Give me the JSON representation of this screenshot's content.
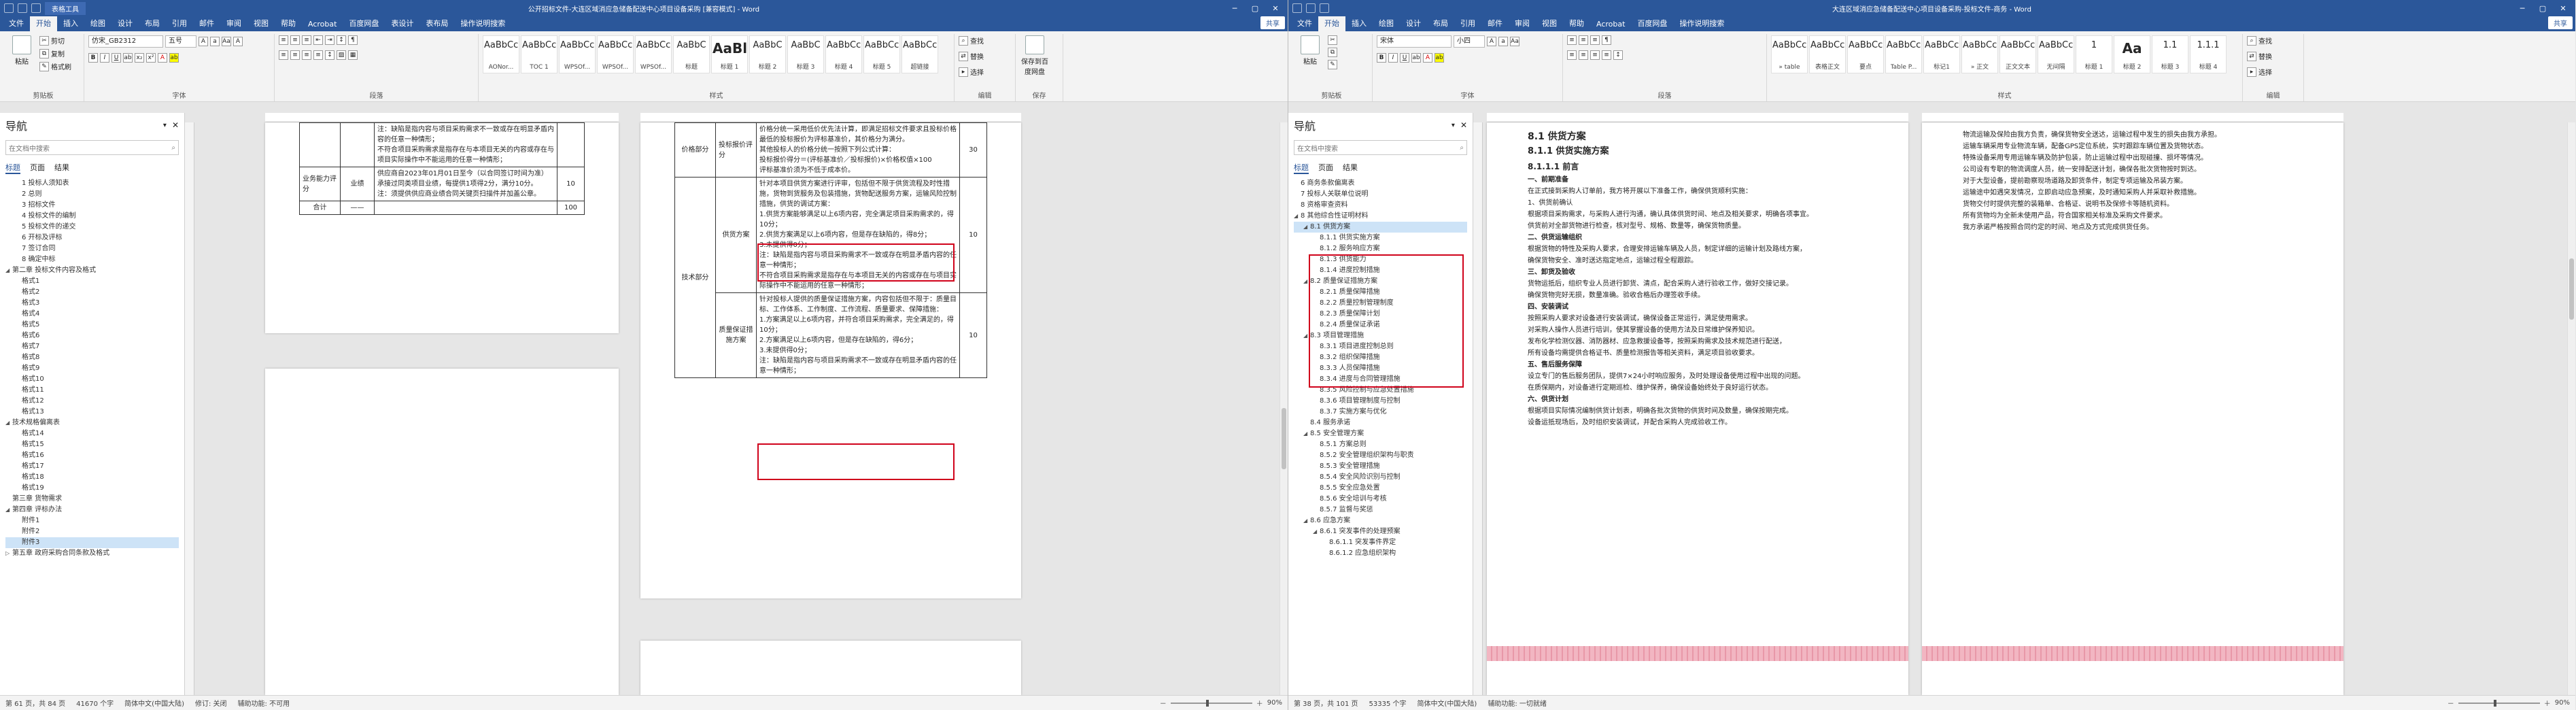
{
  "left": {
    "title": "公开招标文件-大连区域消应急储备配送中心项目设备采购 [兼容模式] - Word",
    "contextual_tab": "表格工具",
    "share": "共享",
    "tabs": [
      "文件",
      "开始",
      "插入",
      "绘图",
      "设计",
      "布局",
      "引用",
      "邮件",
      "审阅",
      "视图",
      "帮助",
      "Acrobat",
      "百度网盘",
      "表设计",
      "表布局",
      "操作说明搜索"
    ],
    "groups": {
      "clipboard": "剪贴板",
      "font": "字体",
      "paragraph": "段落",
      "styles": "样式",
      "editing": "编辑",
      "save": "保存"
    },
    "paste": "粘贴",
    "cut": "剪切",
    "copy": "复制",
    "format_painter": "格式刷",
    "font_name": "仿宋_GB2312",
    "font_size": "五号",
    "find": "查找",
    "replace": "替换",
    "select": "选择",
    "save_to": "保存到百度网盘",
    "styles": [
      {
        "pv": "AaBbCc",
        "nm": "AONor..."
      },
      {
        "pv": "AaBbCc",
        "nm": "TOC 1"
      },
      {
        "pv": "AaBbCc",
        "nm": "WPSOf..."
      },
      {
        "pv": "AaBbCc",
        "nm": "WPSOf..."
      },
      {
        "pv": "AaBbCc",
        "nm": "WPSOf..."
      },
      {
        "pv": "AaBbC",
        "nm": "标题"
      },
      {
        "pv": "AaBl",
        "nm": "标题 1",
        "big": true
      },
      {
        "pv": "AaBbC",
        "nm": "标题 2"
      },
      {
        "pv": "AaBbC",
        "nm": "标题 3"
      },
      {
        "pv": "AaBbCc",
        "nm": "标题 4"
      },
      {
        "pv": "AaBbCc",
        "nm": "标题 5"
      },
      {
        "pv": "AaBbCc",
        "nm": "超链接"
      }
    ],
    "nav": {
      "title": "导航",
      "search_placeholder": "在文档中搜索",
      "tabs": [
        "标题",
        "页面",
        "结果"
      ],
      "items": [
        {
          "t": "1 投标人须知表",
          "l": 1
        },
        {
          "t": "2 总则",
          "l": 1
        },
        {
          "t": "3 招标文件",
          "l": 1
        },
        {
          "t": "4 投标文件的编制",
          "l": 1
        },
        {
          "t": "5 投标文件的递交",
          "l": 1
        },
        {
          "t": "6 开标及评标",
          "l": 1
        },
        {
          "t": "7 签订合同",
          "l": 1
        },
        {
          "t": "8 确定中标",
          "l": 1
        },
        {
          "t": "第二章 投标文件内容及格式",
          "l": 0,
          "a": "◢"
        },
        {
          "t": "格式1",
          "l": 1
        },
        {
          "t": "格式2",
          "l": 1
        },
        {
          "t": "格式3",
          "l": 1
        },
        {
          "t": "格式4",
          "l": 1
        },
        {
          "t": "格式5",
          "l": 1
        },
        {
          "t": "格式6",
          "l": 1
        },
        {
          "t": "格式7",
          "l": 1
        },
        {
          "t": "格式8",
          "l": 1
        },
        {
          "t": "格式9",
          "l": 1
        },
        {
          "t": "格式10",
          "l": 1
        },
        {
          "t": "格式11",
          "l": 1
        },
        {
          "t": "格式12",
          "l": 1
        },
        {
          "t": "格式13",
          "l": 1
        },
        {
          "t": "技术规格偏离表",
          "l": 0,
          "a": "◢"
        },
        {
          "t": "格式14",
          "l": 1
        },
        {
          "t": "格式15",
          "l": 1
        },
        {
          "t": "格式16",
          "l": 1
        },
        {
          "t": "格式17",
          "l": 1
        },
        {
          "t": "格式18",
          "l": 1
        },
        {
          "t": "格式19",
          "l": 1
        },
        {
          "t": "第三章 货物需求",
          "l": 0
        },
        {
          "t": "第四章 评标办法",
          "l": 0,
          "a": "◢"
        },
        {
          "t": "附件1",
          "l": 1
        },
        {
          "t": "附件2",
          "l": 1
        },
        {
          "t": "附件3",
          "l": 1,
          "sel": true
        },
        {
          "t": "第五章 政府采购合同条款及格式",
          "l": 0,
          "a": "▷"
        }
      ]
    },
    "status": {
      "page": "第 61 页，共 84 页",
      "words": "41670 个字",
      "lang": "简体中文(中国大陆)",
      "track": "修订: 关闭",
      "access": "辅助功能: 不可用",
      "zoom": "90%"
    },
    "page1": {
      "rows": [
        {
          "c1": "",
          "c2": "",
          "txt": "注：缺陷是指内容与项目采购需求不一致或存在明显矛盾内容的任意一种情形；\n不符合项目采购需求是指存在与本项目无关的内容或存在与项目实际操作中不能运用的任意一种情形；",
          "score": ""
        },
        {
          "c1": "业务能力评分",
          "c2": "业绩",
          "txt": "供应商自2023年01月01日至今（以合同签订时间为准）承接过同类项目业绩，每提供1项得2分，满分10分。\n注：须提供供应商业绩合同关键页扫描件并加盖公章。",
          "score": "10"
        },
        {
          "c1": "合计",
          "c2": "——",
          "txt": "",
          "score": "100"
        }
      ]
    },
    "page2": {
      "rows": [
        {
          "c1": "价格部分",
          "c2": "投标报价评分",
          "txt": "价格分统一采用低价优先法计算，即满足招标文件要求且投标价格最低的投标报价为评标基准价，其价格分为满分。\n其他投标人的价格分统一按照下列公式计算：\n投标报价得分＝(评标基准价／投标报价)×价格权值×100\n评标基准价须为不低于成本价。",
          "score": "30"
        },
        {
          "c1": "技术部分",
          "c2": "供货方案",
          "txt": "针对本项目供货方案进行评审，包括但不限于供货流程及时性措施，货物到货服务及包装措施，货物配送服务方案，运输风险控制措施，供货的调试方案：\n1.供货方案能够满足以上6项内容，完全满足项目采购需求的，得10分；\n2.供货方案满足以上6项内容，但是存在缺陷的，得8分；\n3.未提供得0分；\n注：缺陷是指内容与项目采购需求不一致或存在明显矛盾内容的任意一种情形；\n不符合项目采购需求是指存在与本项目无关的内容或存在与项目实际操作中不能运用的任意一种情形；",
          "score": "10"
        },
        {
          "c1": "",
          "c2": "质量保证措施方案",
          "txt": "针对投标人提供的质量保证措施方案，内容包括但不限于：质量目标、工作体系、工作制度、工作流程、质量要求、保障措施：\n1.方案满足以上6项内容，并符合项目采购需求，完全满足的，得10分；\n2.方案满足以上6项内容，但是存在缺陷的，得6分；\n3.未提供得0分；\n注：缺陷是指内容与项目采购需求不一致或存在明显矛盾内容的任意一种情形；",
          "score": "10"
        }
      ]
    }
  },
  "right": {
    "title": "大连区域消应急储备配送中心项目设备采购-投标文件-商务 - Word",
    "share": "共享",
    "tabs": [
      "文件",
      "开始",
      "插入",
      "绘图",
      "设计",
      "布局",
      "引用",
      "邮件",
      "审阅",
      "视图",
      "帮助",
      "Acrobat",
      "百度网盘",
      "操作说明搜索"
    ],
    "font_name": "宋体",
    "font_size": "小四",
    "styles": [
      {
        "pv": "AaBbCcDc",
        "nm": "» table"
      },
      {
        "pv": "AaBbCcDc",
        "nm": "表格正文"
      },
      {
        "pv": "AaBbCcD",
        "nm": "要点"
      },
      {
        "pv": "AaBbCcDc",
        "nm": "Table P..."
      },
      {
        "pv": "AaBbCcDc",
        "nm": "标记1"
      },
      {
        "pv": "AaBbCcDc",
        "nm": "» 正文"
      },
      {
        "pv": "AaBbCcDc",
        "nm": "正文文本"
      },
      {
        "pv": "AaBbCcDc",
        "nm": "无间隔"
      },
      {
        "pv": "1",
        "nm": "标题 1"
      },
      {
        "pv": "Aa",
        "nm": "标题 2",
        "big": true
      },
      {
        "pv": "1.1",
        "nm": "标题 3"
      },
      {
        "pv": "1.1.1",
        "nm": "标题 4"
      }
    ],
    "nav": {
      "title": "导航",
      "search_placeholder": "在文档中搜索",
      "tabs": [
        "标题",
        "页面",
        "结果"
      ],
      "items": [
        {
          "t": "6 商务条款偏离表",
          "l": 0
        },
        {
          "t": "7 投标人关联单位说明",
          "l": 0
        },
        {
          "t": "8 资格审查资料",
          "l": 0
        },
        {
          "t": "8 其他综合性证明材料",
          "l": 0,
          "a": "◢"
        },
        {
          "t": "8.1 供货方案",
          "l": 1,
          "a": "◢",
          "sel": true
        },
        {
          "t": "8.1.1 供货实施方案",
          "l": 2
        },
        {
          "t": "8.1.2 服务响应方案",
          "l": 2
        },
        {
          "t": "8.1.3 供货能力",
          "l": 2
        },
        {
          "t": "8.1.4 进度控制措施",
          "l": 2
        },
        {
          "t": "8.2 质量保证措施方案",
          "l": 1,
          "a": "◢"
        },
        {
          "t": "8.2.1 质量保障措施",
          "l": 2
        },
        {
          "t": "8.2.2 质量控制管理制度",
          "l": 2
        },
        {
          "t": "8.2.3 质量保障计划",
          "l": 2
        },
        {
          "t": "8.2.4 质量保证承诺",
          "l": 2
        },
        {
          "t": "8.3 项目管理措施",
          "l": 1,
          "a": "◢"
        },
        {
          "t": "8.3.1 项目进度控制总则",
          "l": 2
        },
        {
          "t": "8.3.2 组织保障措施",
          "l": 2
        },
        {
          "t": "8.3.3 人员保障措施",
          "l": 2
        },
        {
          "t": "8.3.4 进度与合同管理措施",
          "l": 2
        },
        {
          "t": "8.3.5 风险控制与应急处置措施",
          "l": 2
        },
        {
          "t": "8.3.6 项目管理制度与控制",
          "l": 2
        },
        {
          "t": "8.3.7 实施方案与优化",
          "l": 2
        },
        {
          "t": "8.4 服务承诺",
          "l": 1
        },
        {
          "t": "8.5 安全管理方案",
          "l": 1,
          "a": "◢"
        },
        {
          "t": "8.5.1 方案总则",
          "l": 2
        },
        {
          "t": "8.5.2 安全管理组织架构与职责",
          "l": 2
        },
        {
          "t": "8.5.3 安全管理措施",
          "l": 2
        },
        {
          "t": "8.5.4 安全风险识别与控制",
          "l": 2
        },
        {
          "t": "8.5.5 安全应急处置",
          "l": 2
        },
        {
          "t": "8.5.6 安全培训与考核",
          "l": 2
        },
        {
          "t": "8.5.7 监督与奖惩",
          "l": 2
        },
        {
          "t": "8.6 应急方案",
          "l": 1,
          "a": "◢"
        },
        {
          "t": "8.6.1 突发事件的处理预案",
          "l": 2,
          "a": "◢"
        },
        {
          "t": "8.6.1.1 突发事件界定",
          "l": 3
        },
        {
          "t": "8.6.1.2 应急组织架构",
          "l": 3
        }
      ]
    },
    "status": {
      "page": "第 38 页，共 101 页",
      "words": "53335 个字",
      "lang": "简体中文(中国大陆)",
      "access": "辅助功能: 一切就绪",
      "zoom": "90%"
    },
    "doc": {
      "h1": "8.1  供货方案",
      "h2": "8.1.1  供货实施方案",
      "h3": "8.1.1.1  前言",
      "lines1": [
        "一、前期准备",
        "在正式接到采购人订单前，我方将开展以下准备工作，确保供货顺利实施：",
        "1、供货前确认",
        "根据项目采购需求，与采购人进行沟通，确认具体供货时间、地点及相关要求，明确各项事宜。",
        "供货前对全部货物进行检查，核对型号、规格、数量等，确保货物质量。",
        "二、供货运输组织",
        "根据货物的特性及采购人要求，合理安排运输车辆及人员，制定详细的运输计划及路线方案，",
        "确保货物安全、准时送达指定地点，运输过程全程跟踪。",
        "三、卸货及验收",
        "货物运抵后，组织专业人员进行卸货、清点，配合采购人进行验收工作，做好交接记录。",
        "确保货物完好无损，数量准确。验收合格后办理签收手续。",
        "四、安装调试",
        "按照采购人要求对设备进行安装调试，确保设备正常运行，满足使用需求。",
        "对采购人操作人员进行培训，使其掌握设备的使用方法及日常维护保养知识。",
        "发布化学检测仪器、消防器材、应急救援设备等，按照采购需求及技术规范进行配送，",
        "所有设备均需提供合格证书、质量检测报告等相关资料，满足项目验收要求。",
        "五、售后服务保障",
        "设立专门的售后服务团队，提供7×24小时响应服务，及时处理设备使用过程中出现的问题。",
        "在质保期内，对设备进行定期巡检、维护保养，确保设备始终处于良好运行状态。",
        "六、供货计划",
        "根据项目实际情况编制供货计划表，明确各批次货物的供货时间及数量，确保按期完成。",
        "设备运抵现场后，及时组织安装调试，并配合采购人完成验收工作。"
      ],
      "lines2": [
        "物流运输及保险由我方负责，确保货物安全送达，运输过程中发生的损失由我方承担。",
        "运输车辆采用专业物流车辆，配备GPS定位系统，实时跟踪车辆位置及货物状态。",
        "特殊设备采用专用运输车辆及防护包装，防止运输过程中出现碰撞、损坏等情况。",
        "公司设有专职的物流调度人员，统一安排配送计划，确保各批次货物按时到达。",
        "对于大型设备，提前勘察现场道路及卸货条件，制定专项运输及吊装方案。",
        "运输途中如遇突发情况，立即启动应急预案，及时通知采购人并采取补救措施。",
        "货物交付时提供完整的装箱单、合格证、说明书及保修卡等随机资料。",
        "所有货物均为全新未使用产品，符合国家相关标准及采购文件要求。",
        "我方承诺严格按照合同约定的时间、地点及方式完成供货任务。"
      ]
    }
  }
}
